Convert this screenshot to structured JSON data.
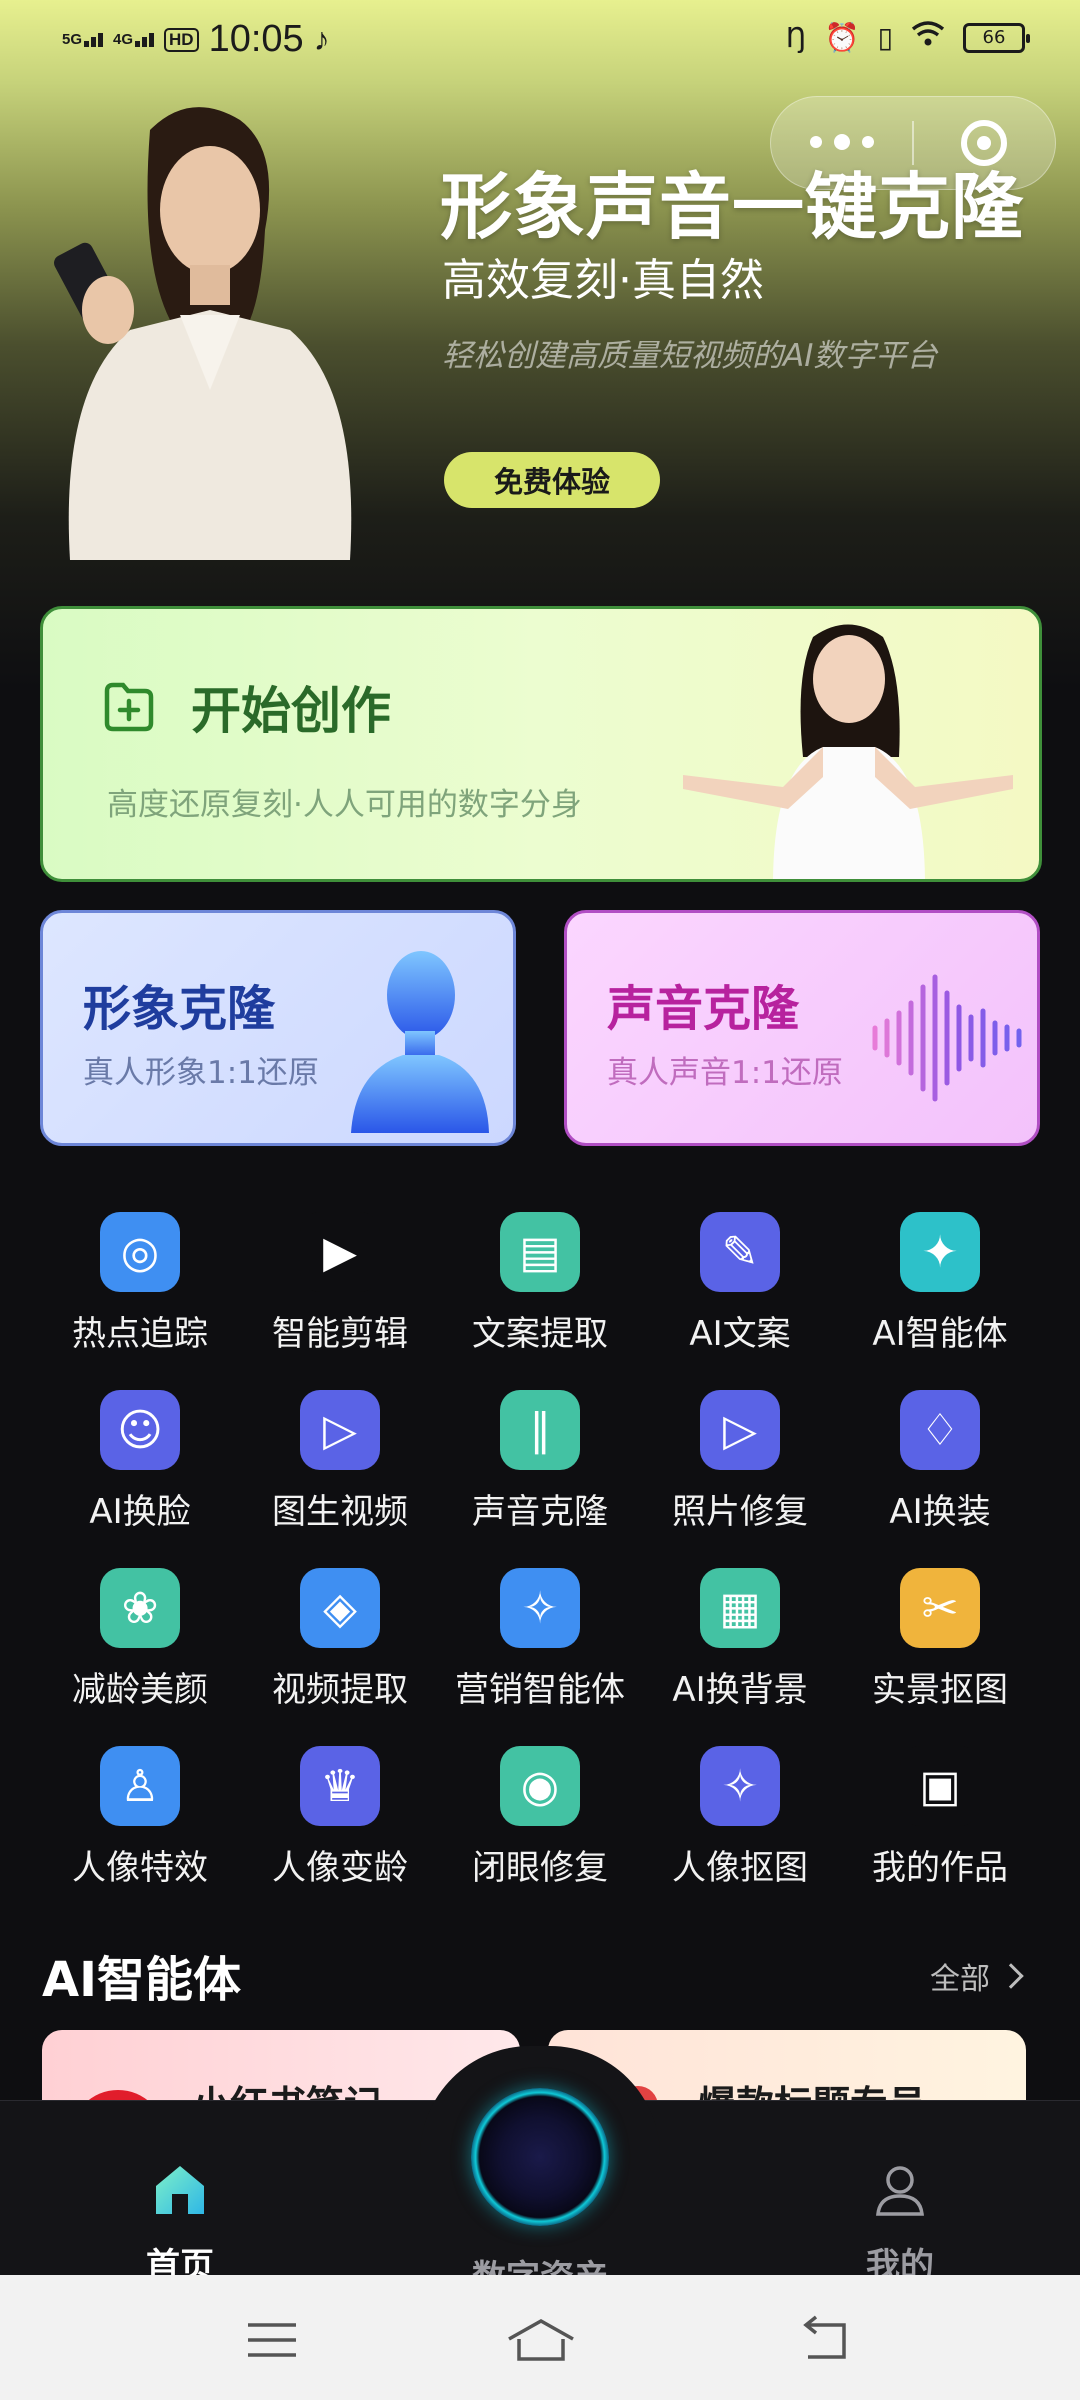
{
  "status_bar": {
    "network1": "5G",
    "network2": "4G",
    "hd": "HD",
    "time": "10:05",
    "battery": "66"
  },
  "hero": {
    "title": "形象声音一键克隆",
    "subtitle": "高效复刻·真自然",
    "description": "轻松创建高质量短视频的AI数字平台",
    "cta_label": "免费体验"
  },
  "start_card": {
    "title": "开始创作",
    "subtitle": "高度还原复刻·人人可用的数字分身"
  },
  "clone_cards": {
    "image": {
      "title": "形象克隆",
      "subtitle": "真人形象1:1还原"
    },
    "voice": {
      "title": "声音克隆",
      "subtitle": "真人声音1:1还原"
    }
  },
  "tools": [
    {
      "label": "热点追踪",
      "icon": "target-icon",
      "color": "#3f8ff2"
    },
    {
      "label": "智能剪辑",
      "icon": "video-edit-icon",
      "color": "#0e0e11"
    },
    {
      "label": "文案提取",
      "icon": "document-extract-icon",
      "color": "#43c2a3"
    },
    {
      "label": "AI文案",
      "icon": "ai-copy-icon",
      "color": "#5a63e6"
    },
    {
      "label": "AI智能体",
      "icon": "sparkle-icon",
      "color": "#2dc1c9"
    },
    {
      "label": "AI换脸",
      "icon": "face-swap-icon",
      "color": "#5a63e6"
    },
    {
      "label": "图生视频",
      "icon": "image-to-video-icon",
      "color": "#5a63e6"
    },
    {
      "label": "声音克隆",
      "icon": "voice-wave-icon",
      "color": "#43c2a3"
    },
    {
      "label": "照片修复",
      "icon": "photo-repair-icon",
      "color": "#5a63e6"
    },
    {
      "label": "AI换装",
      "icon": "outfit-icon",
      "color": "#5a63e6"
    },
    {
      "label": "减龄美颜",
      "icon": "beauty-icon",
      "color": "#43c2a3"
    },
    {
      "label": "视频提取",
      "icon": "video-extract-icon",
      "color": "#3f8ff2"
    },
    {
      "label": "营销智能体",
      "icon": "marketing-agent-icon",
      "color": "#3f8ff2"
    },
    {
      "label": "AI换背景",
      "icon": "background-swap-icon",
      "color": "#43c2a3"
    },
    {
      "label": "实景抠图",
      "icon": "scene-cutout-icon",
      "color": "#f0b43c"
    },
    {
      "label": "人像特效",
      "icon": "portrait-effect-icon",
      "color": "#3f8ff2"
    },
    {
      "label": "人像变龄",
      "icon": "age-change-icon",
      "color": "#5a63e6"
    },
    {
      "label": "闭眼修复",
      "icon": "eye-repair-icon",
      "color": "#43c2a3"
    },
    {
      "label": "人像抠图",
      "icon": "portrait-cutout-icon",
      "color": "#5a63e6"
    },
    {
      "label": "我的作品",
      "icon": "my-works-icon",
      "color": "#0e0e11"
    }
  ],
  "agents_section": {
    "title": "AI智能体",
    "more_label": "全部",
    "cards": [
      {
        "name": "小红书笔记"
      },
      {
        "name": "爆款标题专员"
      }
    ]
  },
  "tab_bar": {
    "home": "首页",
    "assets": "数字资产",
    "mine": "我的"
  }
}
